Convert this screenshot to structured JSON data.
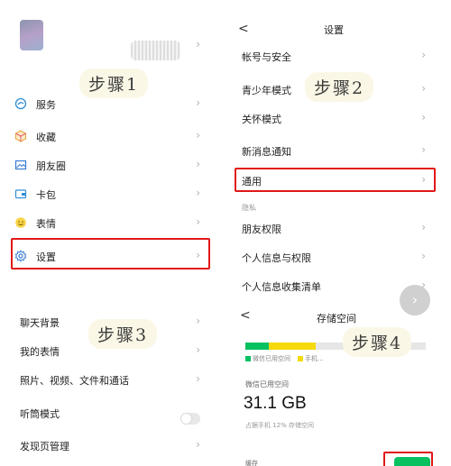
{
  "step1": "步骤1",
  "step2": "步骤2",
  "step3": "步骤3",
  "step4": "步骤4",
  "panel1": {
    "items": [
      {
        "label": "服务",
        "icon": "service-icon"
      },
      {
        "label": "收藏",
        "icon": "favorites-icon"
      },
      {
        "label": "朋友圈",
        "icon": "moments-icon"
      },
      {
        "label": "卡包",
        "icon": "card-wallet-icon"
      },
      {
        "label": "表情",
        "icon": "sticker-icon"
      },
      {
        "label": "设置",
        "icon": "gear-icon"
      }
    ]
  },
  "panel2": {
    "back": "<",
    "title": "设置",
    "items": [
      "帐号与安全",
      "青少年模式",
      "关怀模式",
      "新消息通知",
      "通用"
    ],
    "privacy_label": "隐私",
    "privacy_items": [
      "朋友权限",
      "个人信息与权限",
      "个人信息收集清单"
    ]
  },
  "panel3": {
    "items": [
      "聊天背景",
      "我的表情",
      "照片、视频、文件和通话",
      "听筒模式",
      "发现页管理"
    ]
  },
  "panel4": {
    "back": "<",
    "title": "存储空间",
    "legend_used": "微信已用空间",
    "legend_phone": "手机...",
    "used_label": "微信已用空间",
    "used_value": "31.1 GB",
    "used_note": "占据手机 12% 存储空间",
    "cache_label": "缓存"
  },
  "colors": {
    "highlight": "#e01818",
    "wechat_green": "#07c160",
    "yellow": "#f5d90a"
  }
}
